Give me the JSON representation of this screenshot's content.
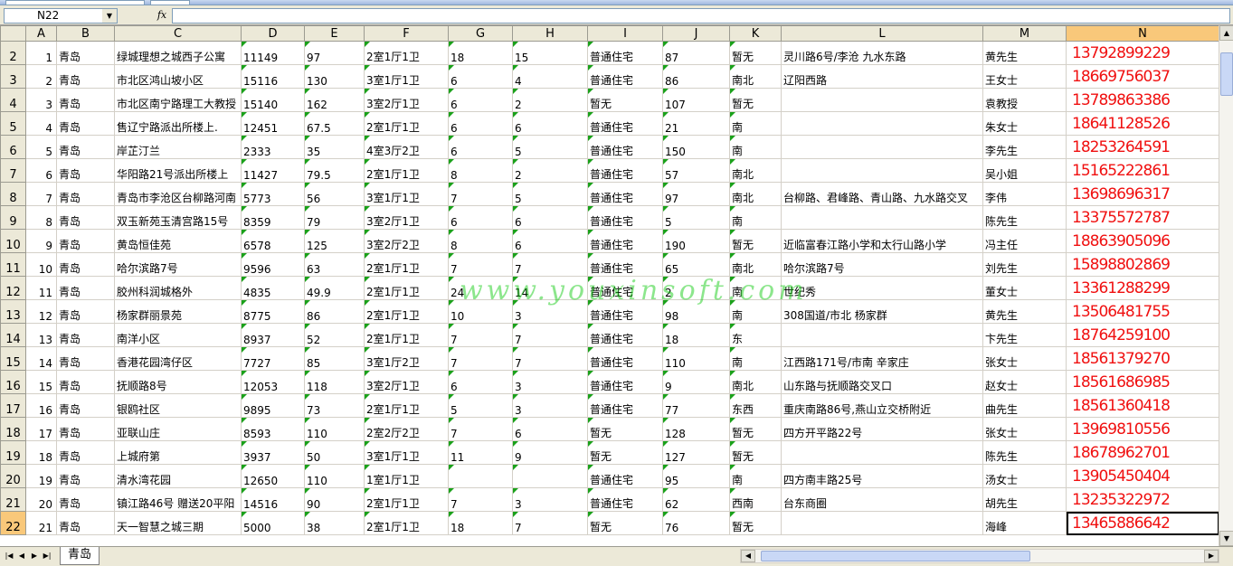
{
  "name_box": {
    "value": "N22"
  },
  "formula_bar": {
    "fx_label": "fx",
    "value": ""
  },
  "columns": [
    "A",
    "B",
    "C",
    "D",
    "E",
    "F",
    "G",
    "H",
    "I",
    "J",
    "K",
    "L",
    "M",
    "N"
  ],
  "selected_column": "N",
  "selected_row": "22",
  "rows": [
    {
      "r": "2",
      "a": "1",
      "b": "青岛",
      "c": "绿城理想之城西子公寓",
      "d": "11149",
      "e": "97",
      "f": "2室1厅1卫",
      "g": "18",
      "h": "15",
      "i": "普通住宅",
      "j": "87",
      "k": "暂无",
      "l": "灵川路6号/李沧 九水东路",
      "m": "黄先生",
      "n": "13792899229"
    },
    {
      "r": "3",
      "a": "2",
      "b": "青岛",
      "c": "市北区鸿山坡小区",
      "d": "15116",
      "e": "130",
      "f": "3室1厅1卫",
      "g": "6",
      "h": "4",
      "i": "普通住宅",
      "j": "86",
      "k": "南北",
      "l": "辽阳西路",
      "m": "王女士",
      "n": "18669756037"
    },
    {
      "r": "4",
      "a": "3",
      "b": "青岛",
      "c": "市北区南宁路理工大教授",
      "d": "15140",
      "e": "162",
      "f": "3室2厅1卫",
      "g": "6",
      "h": "2",
      "i": "暂无",
      "j": "107",
      "k": "暂无",
      "l": "",
      "m": "袁教授",
      "n": "13789863386"
    },
    {
      "r": "5",
      "a": "4",
      "b": "青岛",
      "c": "售辽宁路派出所楼上.",
      "d": "12451",
      "e": "67.5",
      "f": "2室1厅1卫",
      "g": "6",
      "h": "6",
      "i": "普通住宅",
      "j": "21",
      "k": "南",
      "l": "",
      "m": "朱女士",
      "n": "18641128526"
    },
    {
      "r": "6",
      "a": "5",
      "b": "青岛",
      "c": "岸芷汀兰",
      "d": "2333",
      "e": "35",
      "f": "4室3厅2卫",
      "g": "6",
      "h": "5",
      "i": "普通住宅",
      "j": "150",
      "k": "南",
      "l": "",
      "m": "李先生",
      "n": "18253264591"
    },
    {
      "r": "7",
      "a": "6",
      "b": "青岛",
      "c": "华阳路21号派出所楼上",
      "d": "11427",
      "e": "79.5",
      "f": "2室1厅1卫",
      "g": "8",
      "h": "2",
      "i": "普通住宅",
      "j": "57",
      "k": "南北",
      "l": "",
      "m": "吴小姐",
      "n": "15165222861"
    },
    {
      "r": "8",
      "a": "7",
      "b": "青岛",
      "c": "青岛市李沧区台柳路河南",
      "d": "5773",
      "e": "56",
      "f": "3室1厅1卫",
      "g": "7",
      "h": "5",
      "i": "普通住宅",
      "j": "97",
      "k": "南北",
      "l": "台柳路、君峰路、青山路、九水路交叉",
      "m": "李伟",
      "n": "13698696317"
    },
    {
      "r": "9",
      "a": "8",
      "b": "青岛",
      "c": "双玉新苑玉清宫路15号",
      "d": "8359",
      "e": "79",
      "f": "3室2厅1卫",
      "g": "6",
      "h": "6",
      "i": "普通住宅",
      "j": "5",
      "k": "南",
      "l": "",
      "m": "陈先生",
      "n": "13375572787"
    },
    {
      "r": "10",
      "a": "9",
      "b": "青岛",
      "c": "黄岛恒佳苑",
      "d": "6578",
      "e": "125",
      "f": "3室2厅2卫",
      "g": "8",
      "h": "6",
      "i": "普通住宅",
      "j": "190",
      "k": "暂无",
      "l": "近临富春江路小学和太行山路小学",
      "m": "冯主任",
      "n": "18863905096"
    },
    {
      "r": "11",
      "a": "10",
      "b": "青岛",
      "c": "哈尔滨路7号",
      "d": "9596",
      "e": "63",
      "f": "2室1厅1卫",
      "g": "7",
      "h": "7",
      "i": "普通住宅",
      "j": "65",
      "k": "南北",
      "l": "哈尔滨路7号",
      "m": "刘先生",
      "n": "15898802869"
    },
    {
      "r": "12",
      "a": "11",
      "b": "青岛",
      "c": "胶州科润城格外",
      "d": "4835",
      "e": "49.9",
      "f": "2室1厅1卫",
      "g": "24",
      "h": "14",
      "i": "普通住宅",
      "j": "2",
      "k": "南",
      "l": "世纪秀",
      "m": "董女士",
      "n": "13361288299"
    },
    {
      "r": "13",
      "a": "12",
      "b": "青岛",
      "c": "杨家群丽景苑",
      "d": "8775",
      "e": "86",
      "f": "2室1厅1卫",
      "g": "10",
      "h": "3",
      "i": "普通住宅",
      "j": "98",
      "k": "南",
      "l": "308国道/市北 杨家群",
      "m": "黄先生",
      "n": "13506481755"
    },
    {
      "r": "14",
      "a": "13",
      "b": "青岛",
      "c": "南洋小区",
      "d": "8937",
      "e": "52",
      "f": "2室1厅1卫",
      "g": "7",
      "h": "7",
      "i": "普通住宅",
      "j": "18",
      "k": "东",
      "l": "",
      "m": "卞先生",
      "n": "18764259100"
    },
    {
      "r": "15",
      "a": "14",
      "b": "青岛",
      "c": "香港花园湾仔区",
      "d": "7727",
      "e": "85",
      "f": "3室1厅2卫",
      "g": "7",
      "h": "7",
      "i": "普通住宅",
      "j": "110",
      "k": "南",
      "l": "江西路171号/市南 辛家庄",
      "m": "张女士",
      "n": "18561379270"
    },
    {
      "r": "16",
      "a": "15",
      "b": "青岛",
      "c": "抚顺路8号",
      "d": "12053",
      "e": "118",
      "f": "3室2厅1卫",
      "g": "6",
      "h": "3",
      "i": "普通住宅",
      "j": "9",
      "k": "南北",
      "l": "山东路与抚顺路交叉口",
      "m": "赵女士",
      "n": "18561686985"
    },
    {
      "r": "17",
      "a": "16",
      "b": "青岛",
      "c": "银鸥社区",
      "d": "9895",
      "e": "73",
      "f": "2室1厅1卫",
      "g": "5",
      "h": "3",
      "i": "普通住宅",
      "j": "77",
      "k": "东西",
      "l": "重庆南路86号,燕山立交桥附近",
      "m": "曲先生",
      "n": "18561360418"
    },
    {
      "r": "18",
      "a": "17",
      "b": "青岛",
      "c": "亚联山庄",
      "d": "8593",
      "e": "110",
      "f": "2室2厅2卫",
      "g": "7",
      "h": "6",
      "i": "暂无",
      "j": "128",
      "k": "暂无",
      "l": "四方开平路22号",
      "m": "张女士",
      "n": "13969810556"
    },
    {
      "r": "19",
      "a": "18",
      "b": "青岛",
      "c": "上城府第",
      "d": "3937",
      "e": "50",
      "f": "3室1厅1卫",
      "g": "11",
      "h": "9",
      "i": "暂无",
      "j": "127",
      "k": "暂无",
      "l": "",
      "m": "陈先生",
      "n": "18678962701"
    },
    {
      "r": "20",
      "a": "19",
      "b": "青岛",
      "c": "清水湾花园",
      "d": "12650",
      "e": "110",
      "f": "1室1厅1卫",
      "g": "",
      "h": "",
      "i": "普通住宅",
      "j": "95",
      "k": "南",
      "l": "四方南丰路25号",
      "m": "汤女士",
      "n": "13905450404"
    },
    {
      "r": "21",
      "a": "20",
      "b": "青岛",
      "c": "镇江路46号 赠送20平阳",
      "d": "14516",
      "e": "90",
      "f": "2室1厅1卫",
      "g": "7",
      "h": "3",
      "i": "普通住宅",
      "j": "62",
      "k": "西南",
      "l": "台东商圈",
      "m": "胡先生",
      "n": "13235322972"
    },
    {
      "r": "22",
      "a": "21",
      "b": "青岛",
      "c": "天一智慧之城三期",
      "d": "5000",
      "e": "38",
      "f": "2室1厅1卫",
      "g": "18",
      "h": "7",
      "i": "暂无",
      "j": "76",
      "k": "暂无",
      "l": "",
      "m": "海峰",
      "n": "13465886642"
    }
  ],
  "watermark": "www.youxinsoft.com",
  "sheet_tab": {
    "label": "青岛"
  },
  "colors": {
    "phone": "#f01010",
    "selected_header": "#f9c87a",
    "header_bg": "#ece9d8",
    "error_triangle": "#1aa11a"
  }
}
